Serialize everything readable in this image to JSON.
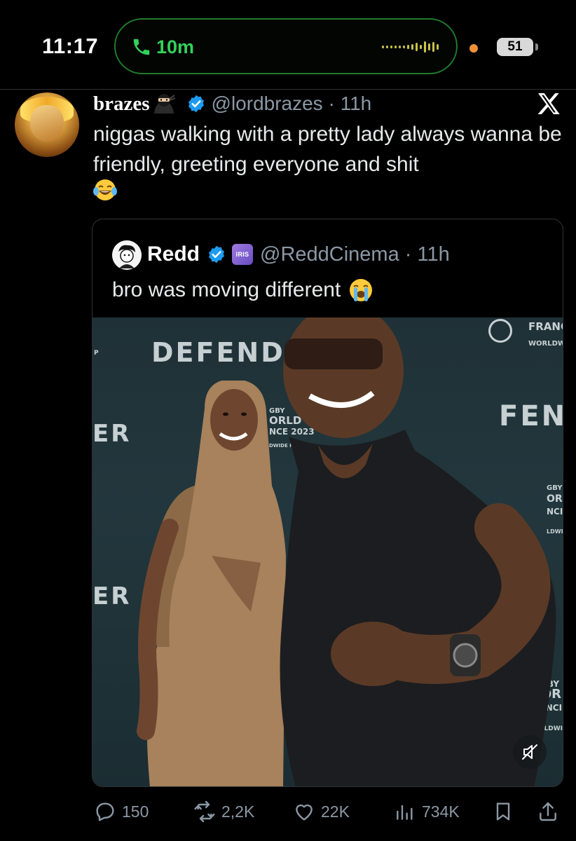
{
  "status_bar": {
    "time": "11:17",
    "call_duration": "10m",
    "battery_level": "51"
  },
  "tweet": {
    "display_name": "brazes",
    "name_emoji": "ninja",
    "handle_time": "@lordbrazes · 11h",
    "text": "niggas walking with a pretty lady always wanna be friendly, greeting everyone and shit",
    "trailing_emoji": "face-with-tears-of-joy",
    "platform_logo": "x-icon"
  },
  "quoted_tweet": {
    "display_name": "Redd",
    "affiliate_badge": "IRIS",
    "handle_time": "@ReddCinema · 11h",
    "text": "bro was moving different",
    "trailing_emoji": "loudly-crying-face",
    "media": {
      "backdrop_words": [
        "DEFENDE",
        "ER",
        "FEN",
        "ER"
      ],
      "backdrop_small_text": [
        "FRANC",
        "WORLDW",
        "GBY",
        "ORLD CUP",
        "NCE 2023",
        "DWIDE PARTNER",
        "RUGBY",
        "WOR",
        "FRANCI",
        "WORLDWI",
        "GBY",
        "OR",
        "NCI",
        "LDWI",
        "P"
      ],
      "muted": true
    }
  },
  "actions": {
    "replies": "150",
    "reposts": "2,2K",
    "likes": "22K",
    "views": "734K"
  },
  "colors": {
    "background": "#000000",
    "text": "#e7e9ea",
    "secondary": "#8b98a5",
    "verified_blue": "#1d9bf0",
    "call_green": "#34d15a",
    "border": "#2f3336"
  }
}
